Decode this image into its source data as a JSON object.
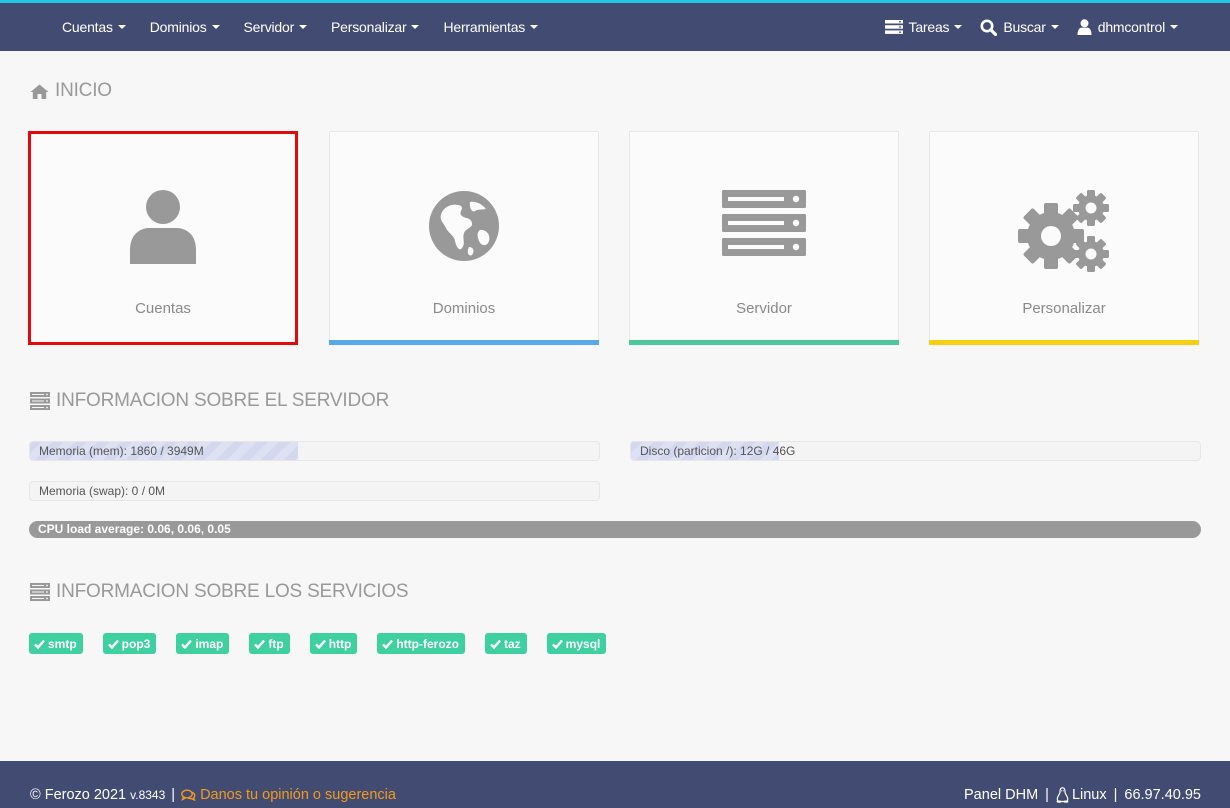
{
  "colors": {
    "navbar": "#424b72",
    "top_accent": "#1fc8e3",
    "selected_outline": "#e4080a",
    "dominios_bar": "#5aa9ec",
    "servidor_bar": "#4cc99c",
    "personalizar_bar": "#f8cd12",
    "badge": "#3fd0a0",
    "feedback_link": "#f39a1c"
  },
  "nav": {
    "left": [
      {
        "label": "Cuentas"
      },
      {
        "label": "Dominios"
      },
      {
        "label": "Servidor"
      },
      {
        "label": "Personalizar"
      },
      {
        "label": "Herramientas"
      }
    ],
    "tasks": {
      "label": "Tareas",
      "icon": "tasks-icon"
    },
    "search": {
      "label": "Buscar",
      "icon": "search-icon"
    },
    "user": {
      "label": "dhmcontrol",
      "icon": "user-icon"
    }
  },
  "home": {
    "title": "INICIO",
    "icon": "home-icon"
  },
  "tiles": [
    {
      "label": "Cuentas",
      "icon": "user-icon",
      "selected": true
    },
    {
      "label": "Dominios",
      "icon": "globe-icon"
    },
    {
      "label": "Servidor",
      "icon": "server-icon"
    },
    {
      "label": "Personalizar",
      "icon": "gears-icon"
    }
  ],
  "server_info": {
    "title": "INFORMACION SOBRE EL SERVIDOR",
    "icon": "server-icon",
    "memory": {
      "label": "Memoria (mem): 1860 / 3949M",
      "used_fraction": 0.471
    },
    "disk": {
      "label": "Disco (particion /): 12G / 46G",
      "used_fraction": 0.26
    },
    "swap": {
      "label": "Memoria (swap): 0 / 0M",
      "used_fraction": 0
    },
    "cpu": {
      "label": "CPU load average: 0.06, 0.06, 0.05"
    }
  },
  "services": {
    "title": "INFORMACION SOBRE LOS SERVICIOS",
    "icon": "server-icon",
    "items": [
      "smtp",
      "pop3",
      "imap",
      "ftp",
      "http",
      "http-ferozo",
      "taz",
      "mysql"
    ]
  },
  "footer": {
    "copyright": "© Ferozo 2021",
    "version": "v.8343",
    "separator": "|",
    "feedback": "Danos tu opinión o sugerencia",
    "panel": "Panel DHM",
    "os": "Linux",
    "ip": "66.97.40.95"
  }
}
